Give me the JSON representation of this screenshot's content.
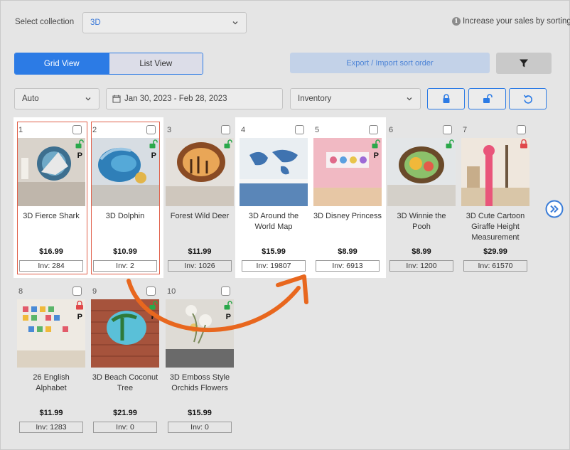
{
  "header": {
    "collection_label": "Select collection",
    "collection_value": "3D",
    "info_text": "Increase your sales by sorting"
  },
  "view_toggle": {
    "grid": "Grid View",
    "list": "List View",
    "active": "grid"
  },
  "toolbar": {
    "export_label": "Export / Import sort order"
  },
  "filters": {
    "sort_mode": "Auto",
    "date_range": "Jan 30, 2023 - Feb 28, 2023",
    "metric": "Inventory"
  },
  "colors": {
    "accent": "#2c7be5",
    "highlight_border": "#e0604a",
    "arrow": "#e8671e",
    "lock_green": "#2aa84a",
    "lock_red": "#e0484a"
  },
  "products": [
    {
      "num": "1",
      "name": "3D Fierce Shark",
      "price": "$16.99",
      "inv": "Inv: 284",
      "lock": "unlocked"
    },
    {
      "num": "2",
      "name": "3D Dolphin",
      "price": "$10.99",
      "inv": "Inv: 2",
      "lock": "unlocked"
    },
    {
      "num": "3",
      "name": "Forest Wild Deer",
      "price": "$11.99",
      "inv": "Inv: 1026",
      "lock": "unlocked"
    },
    {
      "num": "4",
      "name": "3D Around the World Map",
      "price": "$15.99",
      "inv": "Inv: 19807",
      "lock": "none"
    },
    {
      "num": "5",
      "name": "3D Disney Princess",
      "price": "$8.99",
      "inv": "Inv: 6913",
      "lock": "unlocked"
    },
    {
      "num": "6",
      "name": "3D Winnie the Pooh",
      "price": "$8.99",
      "inv": "Inv: 1200",
      "lock": "unlocked"
    },
    {
      "num": "7",
      "name": "3D Cute Cartoon Giraffe Height Measurement",
      "price": "$29.99",
      "inv": "Inv: 61570",
      "lock": "locked"
    },
    {
      "num": "8",
      "name": "26 English Alphabet",
      "price": "$11.99",
      "inv": "Inv: 1283",
      "lock": "locked"
    },
    {
      "num": "9",
      "name": "3D Beach Coconut Tree",
      "price": "$21.99",
      "inv": "Inv: 0",
      "lock": "unlocked"
    },
    {
      "num": "10",
      "name": "3D Emboss Style Orchids Flowers",
      "price": "$15.99",
      "inv": "Inv: 0",
      "lock": "unlocked"
    }
  ]
}
